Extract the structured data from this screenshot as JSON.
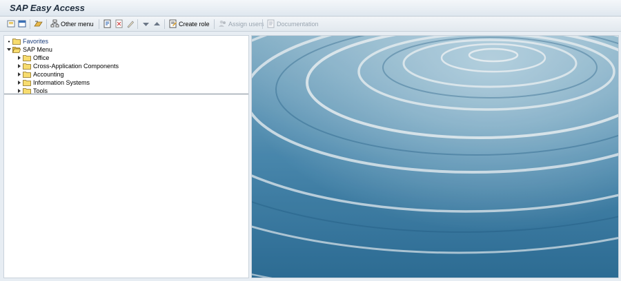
{
  "window": {
    "title": "SAP Easy Access"
  },
  "toolbar": {
    "other_menu": "Other menu",
    "create_role": "Create role",
    "assign_users": "Assign users",
    "documentation": "Documentation"
  },
  "tree": {
    "favorites": "Favorites",
    "sap_menu": "SAP Menu",
    "items": [
      {
        "label": "Office"
      },
      {
        "label": "Cross-Application Components"
      },
      {
        "label": "Accounting"
      },
      {
        "label": "Information Systems"
      },
      {
        "label": "Tools"
      }
    ]
  },
  "colors": {
    "accent": "#1a3c7a",
    "folder": "#f2c94c",
    "water": "#4a88b0"
  },
  "icons": [
    "favorites-add-icon",
    "favorites-edit-icon",
    "user-menu-icon",
    "other-menu-icon",
    "add-to-favorites-icon",
    "delete-favorite-icon",
    "change-favorite-icon",
    "move-down-icon",
    "move-up-icon",
    "create-role-icon",
    "assign-users-icon",
    "documentation-icon"
  ]
}
